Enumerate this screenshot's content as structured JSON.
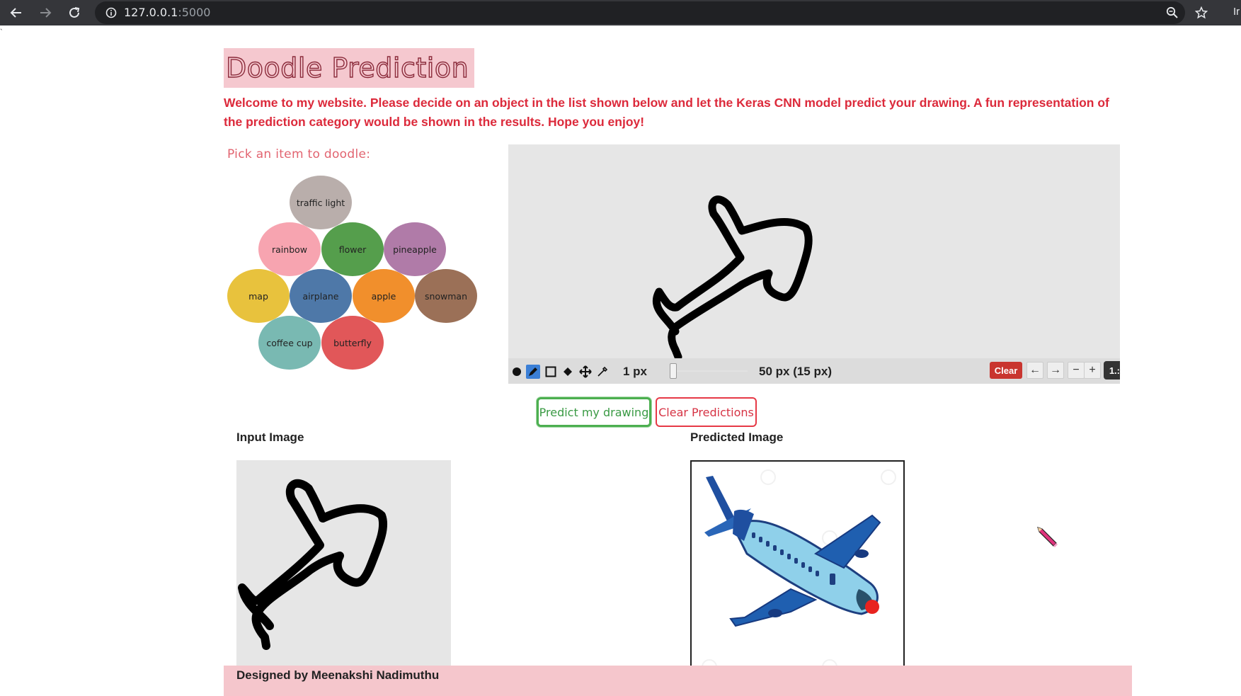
{
  "browser": {
    "url_host": "127.0.0.1",
    "url_port": ":5000",
    "overflow_text": "Ir"
  },
  "page": {
    "title": "Doodle Prediction",
    "welcome": "Welcome to my website. Please decide on an object in the list shown below and let the Keras CNN model predict your drawing. A fun representation of the prediction category would be shown in the results. Hope you enjoy!",
    "pick_label": "Pick an item to doodle:"
  },
  "items": [
    {
      "label": "traffic light",
      "color": "#b9aeab"
    },
    {
      "label": "rainbow",
      "color": "#f7a4b0"
    },
    {
      "label": "flower",
      "color": "#559e4c"
    },
    {
      "label": "pineapple",
      "color": "#b07ba8"
    },
    {
      "label": "map",
      "color": "#e8c23d"
    },
    {
      "label": "airplane",
      "color": "#4e78a8"
    },
    {
      "label": "apple",
      "color": "#f18f2c"
    },
    {
      "label": "snowman",
      "color": "#9b7057"
    },
    {
      "label": "coffee cup",
      "color": "#79b9b2"
    },
    {
      "label": "butterfly",
      "color": "#e15759"
    }
  ],
  "toolbar": {
    "stroke_width": "1 px",
    "brush_size": "50 px (15 px)",
    "clear_label": "Clear",
    "left_arrow": "←",
    "right_arrow": "→",
    "zoom_out": "−",
    "zoom_in": "+",
    "zoom_level": "1.:"
  },
  "actions": {
    "predict_label": "Predict my drawing",
    "clear_predictions_label": "Clear Predictions"
  },
  "results": {
    "input_heading": "Input Image",
    "predicted_heading": "Predicted Image"
  },
  "footer": {
    "credit": "Designed by Meenakshi Nadimuthu"
  },
  "colors": {
    "accent_red": "#dc2a3b",
    "title_bg": "#f5c8cf",
    "canvas_bg": "#e6e6e6",
    "predict_green": "#4caf50"
  }
}
